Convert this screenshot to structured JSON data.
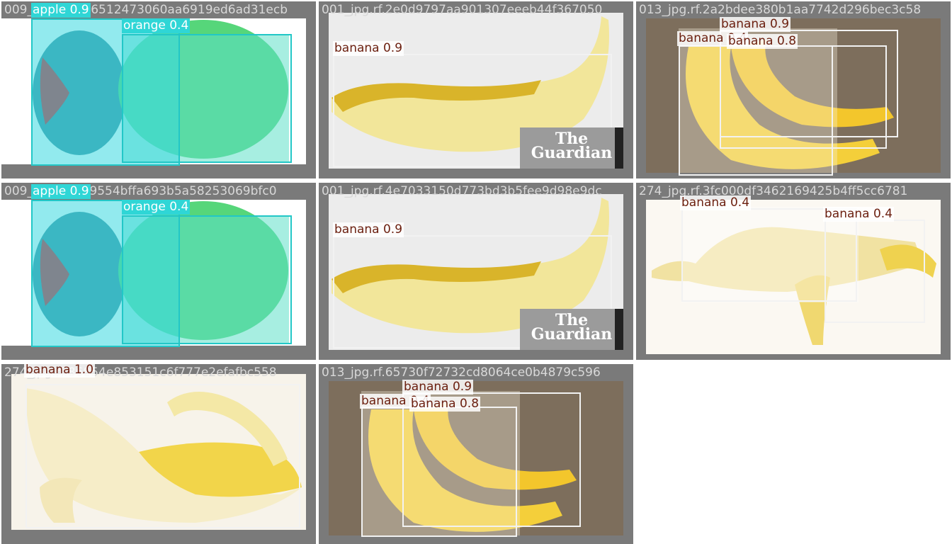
{
  "colors": {
    "tile_bg": "#7a7a7a",
    "banana_box": "#f2f2f2",
    "apple_box": "#22c7c7",
    "label_text": "#6b1f0f"
  },
  "tiles": [
    {
      "filename": "009_jpg.rf.6516512473060aa6919ed6ad31ecb",
      "labels": [
        {
          "class": "apple",
          "text": "apple 0.9"
        },
        {
          "class": "orange",
          "text": "orange 0.4"
        }
      ]
    },
    {
      "filename": "001_jpg.rf.2e0d9797aa901307eeeb44f367050",
      "labels": [
        {
          "class": "banana",
          "text": "banana 0.9"
        }
      ],
      "watermark": [
        "The",
        "Guardian"
      ]
    },
    {
      "filename": "013_jpg.rf.2a2bdee380b1aa7742d296bec3c58",
      "labels": [
        {
          "class": "banana",
          "text": "banana 0.9"
        },
        {
          "class": "banana",
          "text": "banana 0.4"
        },
        {
          "class": "banana",
          "text": "banana 0.8"
        }
      ]
    },
    {
      "filename": "009_jpg.rf.0ec9554bffa693b5a58253069bfc0",
      "labels": [
        {
          "class": "apple",
          "text": "apple 0.9"
        },
        {
          "class": "orange",
          "text": "orange 0.4"
        }
      ]
    },
    {
      "filename": "001_jpg.rf.4e7033150d773bd3b5fee9d98e9dc",
      "labels": [
        {
          "class": "banana",
          "text": "banana 0.9"
        }
      ],
      "watermark": [
        "The",
        "Guardian"
      ]
    },
    {
      "filename": "274_jpg.rf.3fc000df3462169425b4ff5cc6781",
      "labels": [
        {
          "class": "banana",
          "text": "banana 0.4"
        },
        {
          "class": "banana",
          "text": "banana 0.4"
        }
      ]
    },
    {
      "filename": "274_jpg.rf.86854e853151c6f777e2efafbc558",
      "labels": [
        {
          "class": "banana",
          "text": "banana 1.0"
        }
      ]
    },
    {
      "filename": "013_jpg.rf.65730f72732cd8064ce0b4879c596",
      "labels": [
        {
          "class": "banana",
          "text": "banana 0.9"
        },
        {
          "class": "banana",
          "text": "banana 0.4"
        },
        {
          "class": "banana",
          "text": "banana 0.8"
        }
      ]
    }
  ]
}
